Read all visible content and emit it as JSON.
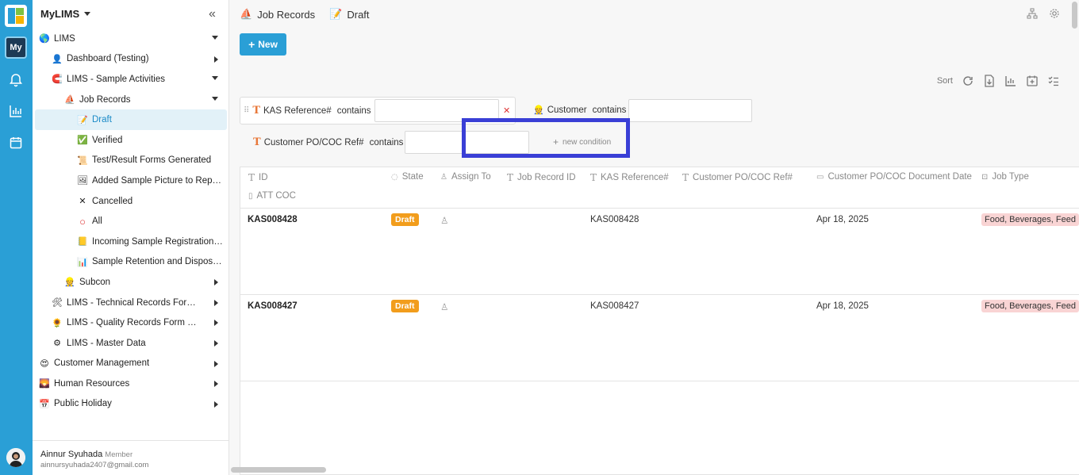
{
  "app": {
    "name": "MyLIMS",
    "rail_my": "My"
  },
  "sidebar": {
    "items": [
      {
        "label": "LIMS",
        "icon": "globe-icon",
        "emoji": "🌎",
        "level": 0,
        "arrow": "down"
      },
      {
        "label": "Dashboard (Testing)",
        "icon": "user-icon",
        "emoji": "👤",
        "level": 1,
        "arrow": "right"
      },
      {
        "label": "LIMS - Sample Activities",
        "icon": "magnet-icon",
        "emoji": "🧲",
        "level": 1,
        "arrow": "down"
      },
      {
        "label": "Job Records",
        "icon": "flask-icon",
        "emoji": "⛵",
        "level": 2,
        "arrow": "down"
      },
      {
        "label": "Draft",
        "icon": "memo-icon",
        "emoji": "📝",
        "level": 3,
        "arrow": "",
        "selected": true
      },
      {
        "label": "Verified",
        "icon": "check-icon",
        "emoji": "✅",
        "level": 3,
        "arrow": ""
      },
      {
        "label": "Test/Result Forms Generated",
        "icon": "scroll-icon",
        "emoji": "📜",
        "level": 3,
        "arrow": ""
      },
      {
        "label": "Added Sample Picture to Repor...",
        "icon": "picture-icon",
        "emoji": "🖼",
        "level": 3,
        "arrow": ""
      },
      {
        "label": "Cancelled",
        "icon": "x-icon",
        "emoji": "✕",
        "level": 3,
        "arrow": ""
      },
      {
        "label": "All",
        "icon": "circle-icon",
        "emoji": "○",
        "level": 3,
        "arrow": ""
      },
      {
        "label": "Incoming Sample Registration ...",
        "icon": "notebook-icon",
        "emoji": "📒",
        "level": 3,
        "arrow": ""
      },
      {
        "label": "Sample Retention and Disposal...",
        "icon": "chart-icon",
        "emoji": "📊",
        "level": 3,
        "arrow": ""
      },
      {
        "label": "Subcon",
        "icon": "person-icon",
        "emoji": "👷",
        "level": 2,
        "arrow": "right"
      },
      {
        "label": "LIMS - Technical Records Form (T...",
        "icon": "tools-icon",
        "emoji": "🛠",
        "level": 1,
        "arrow": "right"
      },
      {
        "label": "LIMS - Quality Records Form (QRF)",
        "icon": "sunflower-icon",
        "emoji": "🌻",
        "level": 1,
        "arrow": "right"
      },
      {
        "label": "LIMS - Master Data",
        "icon": "gear-icon",
        "emoji": "⚙",
        "level": 1,
        "arrow": "right"
      },
      {
        "label": "Customer Management",
        "icon": "smiley-icon",
        "emoji": "😍",
        "level": 0,
        "arrow": "right"
      },
      {
        "label": "Human Resources",
        "icon": "sunset-icon",
        "emoji": "🌄",
        "level": 0,
        "arrow": "right"
      },
      {
        "label": "Public Holiday",
        "icon": "calendar-icon",
        "emoji": "📅",
        "level": 0,
        "arrow": "right"
      }
    ],
    "user": {
      "name": "Ainnur Syuhada",
      "role": "Member",
      "email": "ainnursyuhada2407@gmail.com"
    }
  },
  "header": {
    "crumb1": "Job Records",
    "crumb2": "Draft",
    "new_button": "New"
  },
  "toolbar": {
    "sort_label": "Sort"
  },
  "filters": {
    "f1_field": "KAS Reference#",
    "f1_op": "contains",
    "f1_value": "",
    "f2_field": "Customer",
    "f2_op": "contains",
    "f2_value": "",
    "f3_field": "Customer PO/COC Ref#",
    "f3_op": "contains",
    "f3_value": "",
    "new_condition": "new condition"
  },
  "table": {
    "columns": [
      "ID",
      "State",
      "Assign To",
      "Job Record ID",
      "KAS Reference#",
      "Customer PO/COC Ref#",
      "Customer PO/COC Document Date",
      "Job Type",
      "ATT COC"
    ],
    "rows": [
      {
        "id": "KAS008428",
        "state": "Draft",
        "kas_ref": "KAS008428",
        "doc_date": "Apr 18, 2025",
        "job_type": "Food, Beverages, Feed"
      },
      {
        "id": "KAS008427",
        "state": "Draft",
        "kas_ref": "KAS008427",
        "doc_date": "Apr 18, 2025",
        "job_type": "Food, Beverages, Feed"
      }
    ]
  },
  "colors": {
    "accent": "#2a9fd6",
    "draft_badge": "#f29d1c",
    "highlight": "#3a3fd6",
    "tag_bg": "#f9d4d4"
  }
}
